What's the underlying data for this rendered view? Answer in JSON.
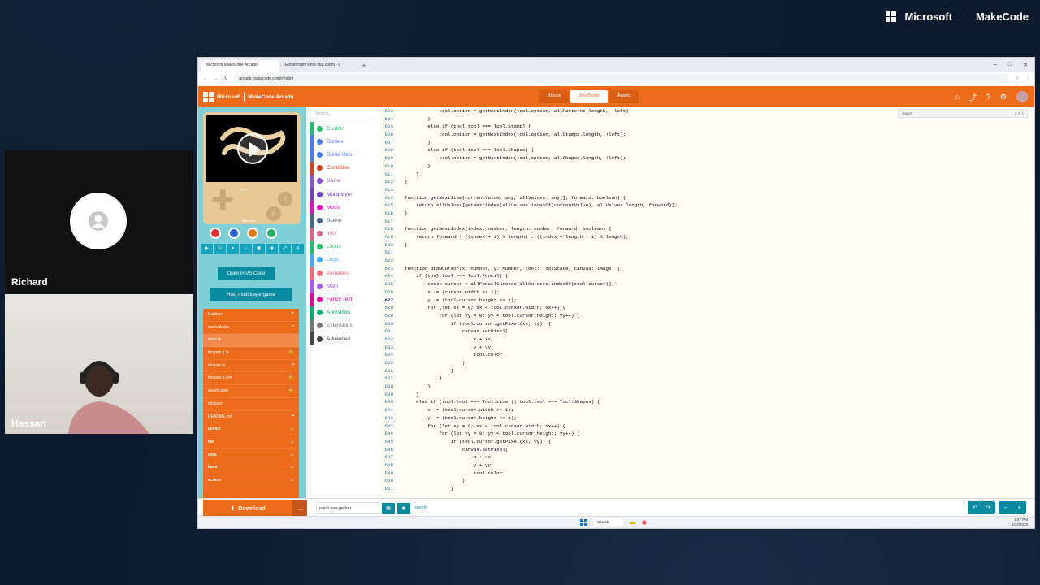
{
  "brand": {
    "company": "Microsoft",
    "product": "MakeCode"
  },
  "participants": [
    {
      "name": "Richard",
      "kind": "avatar"
    },
    {
      "name": "Hassan",
      "kind": "video"
    }
  ],
  "browser": {
    "tabs": [
      "Microsoft MakeCode Arcade",
      "Einsenhaim's fire.vbg.cb8m - v"
    ],
    "url": "arcade.makecode.com/#editor",
    "window_buttons": [
      "–",
      "□",
      "✕"
    ]
  },
  "makecode": {
    "logo": "Microsoft",
    "product": "MakeCode Arcade",
    "modes": [
      {
        "label": "Blocks",
        "active": false
      },
      {
        "label": "JavaScript",
        "active": true
      },
      {
        "label": "Assets",
        "active": false
      }
    ],
    "header_icons": [
      "home-icon",
      "share-icon",
      "help-icon",
      "settings-icon",
      "profile-icon"
    ],
    "simulator": {
      "a_label": "A",
      "b_label": "B",
      "brand": "Microsoft",
      "menu": "Menu"
    },
    "buttons": {
      "open_vscode": "Open in VS Code",
      "host_multiplayer": "Host multiplayer game"
    },
    "search_placeholder": "Search...",
    "explorer": [
      {
        "label": "Explorer",
        "icon": "+",
        "bold": false,
        "selected": false
      },
      {
        "label": "main.blocks",
        "icon": "▪",
        "bold": false,
        "selected": false
      },
      {
        "label": "main.ts",
        "icon": "",
        "bold": false,
        "selected": true
      },
      {
        "label": "images.g.ts",
        "icon": "🔒",
        "bold": false,
        "selected": false
      },
      {
        "label": "shapes.ts",
        "icon": "▪",
        "bold": false,
        "selected": false
      },
      {
        "label": "images.g.jres",
        "icon": "🔒",
        "bold": false,
        "selected": false
      },
      {
        "label": "assets.json",
        "icon": "🔒",
        "bold": false,
        "selected": false
      },
      {
        "label": "pxt.json",
        "icon": "",
        "bold": false,
        "selected": false
      },
      {
        "label": "README.md",
        "icon": "▪",
        "bold": false,
        "selected": false
      },
      {
        "label": "device",
        "icon": "⌄",
        "bold": true,
        "selected": false
      },
      {
        "label": "hw",
        "icon": "⌄",
        "bold": true,
        "selected": false
      },
      {
        "label": "core",
        "icon": "⌄",
        "bold": true,
        "selected": false
      },
      {
        "label": "base",
        "icon": "⌄",
        "bold": true,
        "selected": false
      },
      {
        "label": "screen",
        "icon": "⌄",
        "bold": true,
        "selected": false
      }
    ],
    "categories": [
      {
        "label": "Custom",
        "color": "#20bf6b"
      },
      {
        "label": "Sprites",
        "color": "#4b7bec"
      },
      {
        "label": "Sprite Utils",
        "color": "#4b7bec"
      },
      {
        "label": "Controller",
        "color": "#d54322"
      },
      {
        "label": "Game",
        "color": "#8854d0"
      },
      {
        "label": "Multiplayer",
        "color": "#6f42c1"
      },
      {
        "label": "Music",
        "color": "#e30fc0"
      },
      {
        "label": "Scene",
        "color": "#4b6584"
      },
      {
        "label": "Info",
        "color": "#cf6a87"
      },
      {
        "label": "Loops",
        "color": "#20bf6b"
      },
      {
        "label": "Logic",
        "color": "#45aaf2"
      },
      {
        "label": "Variables",
        "color": "#ff6680"
      },
      {
        "label": "Math",
        "color": "#a55eea"
      },
      {
        "label": "Fancy Text",
        "color": "#e5009f"
      },
      {
        "label": "Animation",
        "color": "#03aa74"
      },
      {
        "label": "Extensions",
        "color": "#777777"
      },
      {
        "label": "Advanced",
        "color": "#444444"
      }
    ],
    "find": {
      "query": "drawC",
      "count": "1 of 1"
    },
    "code": [
      {
        "n": "603",
        "t": "            tool.option = getNextIndex(tool.option, allPatterns.length, !left);"
      },
      {
        "n": "604",
        "t": "        }"
      },
      {
        "n": "605",
        "t": "        else if (tool.tool === Tool.Stamp) {"
      },
      {
        "n": "606",
        "t": "            tool.option = getNextIndex(tool.option, allStamps.length, !left);"
      },
      {
        "n": "607",
        "t": "        }"
      },
      {
        "n": "608",
        "t": "        else if (tool.tool === Tool.Shapes) {"
      },
      {
        "n": "609",
        "t": "            tool.option = getNextIndex(tool.option, allShapes.length, !left);"
      },
      {
        "n": "610",
        "t": "        }"
      },
      {
        "n": "611",
        "t": "    }"
      },
      {
        "n": "612",
        "t": "}"
      },
      {
        "n": "613",
        "t": ""
      },
      {
        "n": "614",
        "t": "function getNextItem(currentValue: any, allValues: any[], forward: boolean) {"
      },
      {
        "n": "615",
        "t": "    return allValues[getNextIndex(allValues.indexOf(currentValue), allValues.length, forward)];"
      },
      {
        "n": "616",
        "t": "}"
      },
      {
        "n": "617",
        "t": ""
      },
      {
        "n": "618",
        "t": "function getNextIndex(index: number, length: number, forward: boolean) {"
      },
      {
        "n": "619",
        "t": "    return forward ? ((index + 1) % length) : ((index + length - 1) % length);"
      },
      {
        "n": "620",
        "t": "}"
      },
      {
        "n": "621",
        "t": ""
      },
      {
        "n": "622",
        "t": ""
      },
      {
        "n": "623",
        "t": "function drawCursor(x: number, y: number, tool: ToolState, canvas: Image) {"
      },
      {
        "n": "624",
        "t": "    if (tool.tool === Tool.Pencil) {"
      },
      {
        "n": "625",
        "t": "        const cursor = allPencilCursors[allCursors.indexOf(tool.cursor)];"
      },
      {
        "n": "626",
        "t": "        x -= (cursor.width >> 1);"
      },
      {
        "n": "627",
        "t": "        y -= (tool.cursor.height >> 1);"
      },
      {
        "n": "628",
        "t": "        for (let xx = 0; xx < tool.cursor.width; xx++) {"
      },
      {
        "n": "629",
        "t": "            for (let yy = 0; yy < tool.cursor.height; yy++) {"
      },
      {
        "n": "630",
        "t": "                if (tool.cursor.getPixel(xx, yy)) {"
      },
      {
        "n": "631",
        "t": "                    canvas.setPixel("
      },
      {
        "n": "632",
        "t": "                        x + xx,"
      },
      {
        "n": "633",
        "t": "                        y + yy,"
      },
      {
        "n": "634",
        "t": "                        tool.color"
      },
      {
        "n": "635",
        "t": "                    )"
      },
      {
        "n": "636",
        "t": "                }"
      },
      {
        "n": "637",
        "t": "            }"
      },
      {
        "n": "638",
        "t": "        }"
      },
      {
        "n": "639",
        "t": "    }"
      },
      {
        "n": "640",
        "t": "    else if (tool.tool === Tool.Line || tool.tool === Tool.Shapes) {"
      },
      {
        "n": "641",
        "t": "        x -= (tool.cursor.width >> 1);"
      },
      {
        "n": "642",
        "t": "        y -= (tool.cursor.height >> 1);"
      },
      {
        "n": "643",
        "t": "        for (let xx = 0; xx < tool.cursor.width; xx++) {"
      },
      {
        "n": "644",
        "t": "            for (let yy = 0; yy < tool.cursor.height; yy++) {"
      },
      {
        "n": "645",
        "t": "                if (tool.cursor.getPixel(xx, yy)) {"
      },
      {
        "n": "646",
        "t": "                    canvas.setPixel("
      },
      {
        "n": "647",
        "t": "                        x + xx,"
      },
      {
        "n": "648",
        "t": "                        y + yy,"
      },
      {
        "n": "649",
        "t": "                        tool.color"
      },
      {
        "n": "650",
        "t": "                    )"
      },
      {
        "n": "651",
        "t": "                }"
      }
    ],
    "current_line": "627",
    "download": "Download",
    "project_name": "paint two-gether",
    "status": "saved!"
  },
  "taskbar": {
    "search": "Search",
    "time": "1:57 PM",
    "date": "8/12/2025"
  },
  "colors": {
    "accent": "#ec6c1c",
    "teal": "#0a8a9f",
    "sim_bg": "#7ed0d6"
  }
}
